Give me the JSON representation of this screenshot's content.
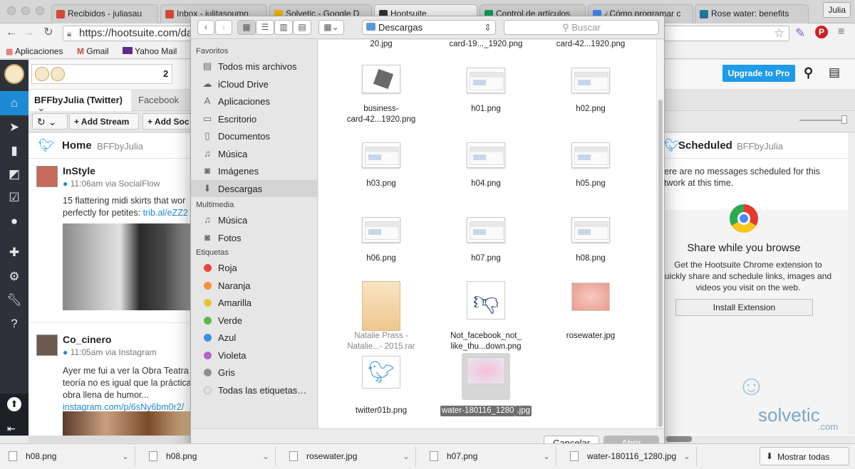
{
  "browser": {
    "tabs": [
      {
        "label": "Recibidos - juliasau",
        "icon_color": "#d14836"
      },
      {
        "label": "Inbox - julitasoumo",
        "icon_color": "#d14836"
      },
      {
        "label": "Solvetic - Google D",
        "icon_color": "#f4b400"
      },
      {
        "label": "Hootsuite",
        "icon_color": "#333333"
      },
      {
        "label": "Control de artículos",
        "icon_color": "#0f9d58"
      },
      {
        "label": "¿Cómo programar c",
        "icon_color": "#4285f4"
      },
      {
        "label": "Rose water: benefits",
        "icon_color": "#21759b"
      }
    ],
    "user": "Julia",
    "url": "https://hootsuite.com/das",
    "bookmarks": [
      {
        "label": "Aplicaciones",
        "icon": "apps-grid-icon"
      },
      {
        "label": "Gmail",
        "icon": "gmail-icon"
      },
      {
        "label": "Yahoo Mail",
        "icon": "yahoo-icon"
      }
    ]
  },
  "hootsuite": {
    "search_count": "2",
    "upgrade_label": "Upgrade to Pro",
    "tabs": [
      {
        "label": "BFFbyJulia (Twitter)",
        "close": "×"
      },
      {
        "label": "Facebook"
      }
    ],
    "add_stream": "+ Add Stream",
    "add_social": "+ Add Soc",
    "stream": {
      "title": "Home",
      "account": "BFFbyJulia",
      "tweets": [
        {
          "name": "InStyle",
          "meta": "11:06am via SocialFlow",
          "text": "15 flattering midi skirts that wor",
          "text2": "perfectly for petites: ",
          "link": "trib.al/eZZ2"
        },
        {
          "name": "Co_cinero",
          "meta": "11:05am via Instagram",
          "text": "Ayer me fui a ver la Obra Teatra",
          "text2": "teoría no es igual que la práctica",
          "text3": "obra llena de humor...",
          "link": "instagram.com/p/6sNy6bm0r2/"
        }
      ]
    },
    "scheduled": {
      "title": "Scheduled",
      "account": "BFFbyJulia",
      "message_line1": "ere are no messages scheduled for this",
      "message_line2": "twork at this time.",
      "share_title": "Share while you browse",
      "share_line1": "Get the Hootsuite Chrome extension to",
      "share_line2": "uickly share and schedule links, images and",
      "share_line3": "videos you visit on the web.",
      "install_label": "Install Extension"
    },
    "watermark": "solvetic",
    "watermark_sub": ".com"
  },
  "dialog": {
    "location": "Descargas",
    "search_placeholder": "Buscar",
    "favoritos_label": "Favoritos",
    "favoritos": [
      {
        "label": "Todos mis archivos",
        "icon": "all-files-icon",
        "glyph": "▤"
      },
      {
        "label": "iCloud Drive",
        "icon": "cloud-icon",
        "glyph": "☁"
      },
      {
        "label": "Aplicaciones",
        "icon": "applications-icon",
        "glyph": "A"
      },
      {
        "label": "Escritorio",
        "icon": "desktop-icon",
        "glyph": "▭"
      },
      {
        "label": "Documentos",
        "icon": "documents-icon",
        "glyph": "▯"
      },
      {
        "label": "Música",
        "icon": "music-icon",
        "glyph": "♫"
      },
      {
        "label": "Imágenes",
        "icon": "camera-icon",
        "glyph": "◙"
      },
      {
        "label": "Descargas",
        "icon": "downloads-icon",
        "glyph": "⬇",
        "selected": true
      }
    ],
    "multimedia_label": "Multimedia",
    "multimedia": [
      {
        "label": "Música",
        "icon": "music-icon",
        "glyph": "♫"
      },
      {
        "label": "Fotos",
        "icon": "camera-icon",
        "glyph": "◙"
      }
    ],
    "etiquetas_label": "Etiquetas",
    "etiquetas": [
      {
        "label": "Roja",
        "color": "#e8473f"
      },
      {
        "label": "Naranja",
        "color": "#f0913a"
      },
      {
        "label": "Amarilla",
        "color": "#e8c23a"
      },
      {
        "label": "Verde",
        "color": "#5bba47"
      },
      {
        "label": "Azul",
        "color": "#3a8ee8"
      },
      {
        "label": "Violeta",
        "color": "#b565c9"
      },
      {
        "label": "Gris",
        "color": "#8e8e8e"
      },
      {
        "label": "Todas las etiquetas…",
        "color": "#e2e2e2"
      }
    ],
    "files": [
      {
        "name": "20.jpg",
        "thumb": "none"
      },
      {
        "name": "card-19..._1920.png",
        "thumb": "none"
      },
      {
        "name": "card-42...1920.png",
        "thumb": "none"
      },
      {
        "name": "business-\ncard-42...1920.png",
        "thumb": "card"
      },
      {
        "name": "h01.png",
        "thumb": "screen"
      },
      {
        "name": "h02.png",
        "thumb": "screen"
      },
      {
        "name": "h03.png",
        "thumb": "screen"
      },
      {
        "name": "h04.png",
        "thumb": "screen"
      },
      {
        "name": "h05.png",
        "thumb": "screen"
      },
      {
        "name": "h06.png",
        "thumb": "screen"
      },
      {
        "name": "h07.png",
        "thumb": "screen"
      },
      {
        "name": "h08.png",
        "thumb": "screen"
      },
      {
        "name": "Natalie Prass -\nNatalie...- 2015.rar",
        "thumb": "rar",
        "dim": true
      },
      {
        "name": "Not_facebook_not_\nlike_thu...down.png",
        "thumb": "dislike"
      },
      {
        "name": "rosewater.jpg",
        "thumb": "rose"
      },
      {
        "name": "twitter01b.png",
        "thumb": "twitter"
      },
      {
        "name": "water-180116_1280\n.jpg",
        "thumb": "water",
        "selected": true
      }
    ],
    "cancel_label": "Cancelar",
    "open_label": "Abrir"
  },
  "downloads": {
    "items": [
      "h08.png",
      "h08.png",
      "rosewater.jpg",
      "h07.png",
      "water-180116_1280.jpg"
    ],
    "show_all": "Mostrar todas"
  }
}
